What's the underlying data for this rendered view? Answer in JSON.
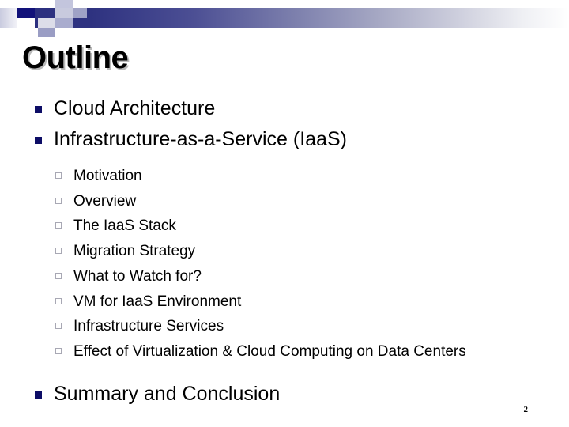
{
  "slide": {
    "title": "Outline",
    "page_number": "2",
    "theme": {
      "band_start_color": "#2b2f7f",
      "band_end_color": "#ffffff",
      "level1_bullet_color": "#0d0d66",
      "level2_bullet_color": "#a8a8b4",
      "title_color": "#000000",
      "title_shadow_color": "#b9b9b9",
      "background_color": "#ffffff"
    },
    "decoration": {
      "navy_square_color": "#12127a",
      "lavender_square_color": "#9fa2c6"
    },
    "bullets": [
      {
        "level": 1,
        "text": "Cloud Architecture",
        "marker": "filled-square-bullet"
      },
      {
        "level": 1,
        "text": "Infrastructure-as-a-Service (IaaS)",
        "marker": "filled-square-bullet"
      }
    ],
    "sub_bullets": [
      {
        "level": 2,
        "text": "Motivation",
        "marker": "hollow-square-bullet"
      },
      {
        "level": 2,
        "text": "Overview",
        "marker": "hollow-square-bullet"
      },
      {
        "level": 2,
        "text": "The IaaS Stack",
        "marker": "hollow-square-bullet"
      },
      {
        "level": 2,
        "text": "Migration Strategy",
        "marker": "hollow-square-bullet"
      },
      {
        "level": 2,
        "text": "What to Watch for?",
        "marker": "hollow-square-bullet"
      },
      {
        "level": 2,
        "text": "VM for IaaS Environment",
        "marker": "hollow-square-bullet"
      },
      {
        "level": 2,
        "text": "Infrastructure Services",
        "marker": "hollow-square-bullet"
      },
      {
        "level": 2,
        "text": "Effect of Virtualization & Cloud Computing on Data Centers",
        "marker": "hollow-square-bullet"
      }
    ],
    "summary_bullet": {
      "level": 1,
      "text": "Summary and Conclusion",
      "marker": "filled-square-bullet"
    }
  }
}
